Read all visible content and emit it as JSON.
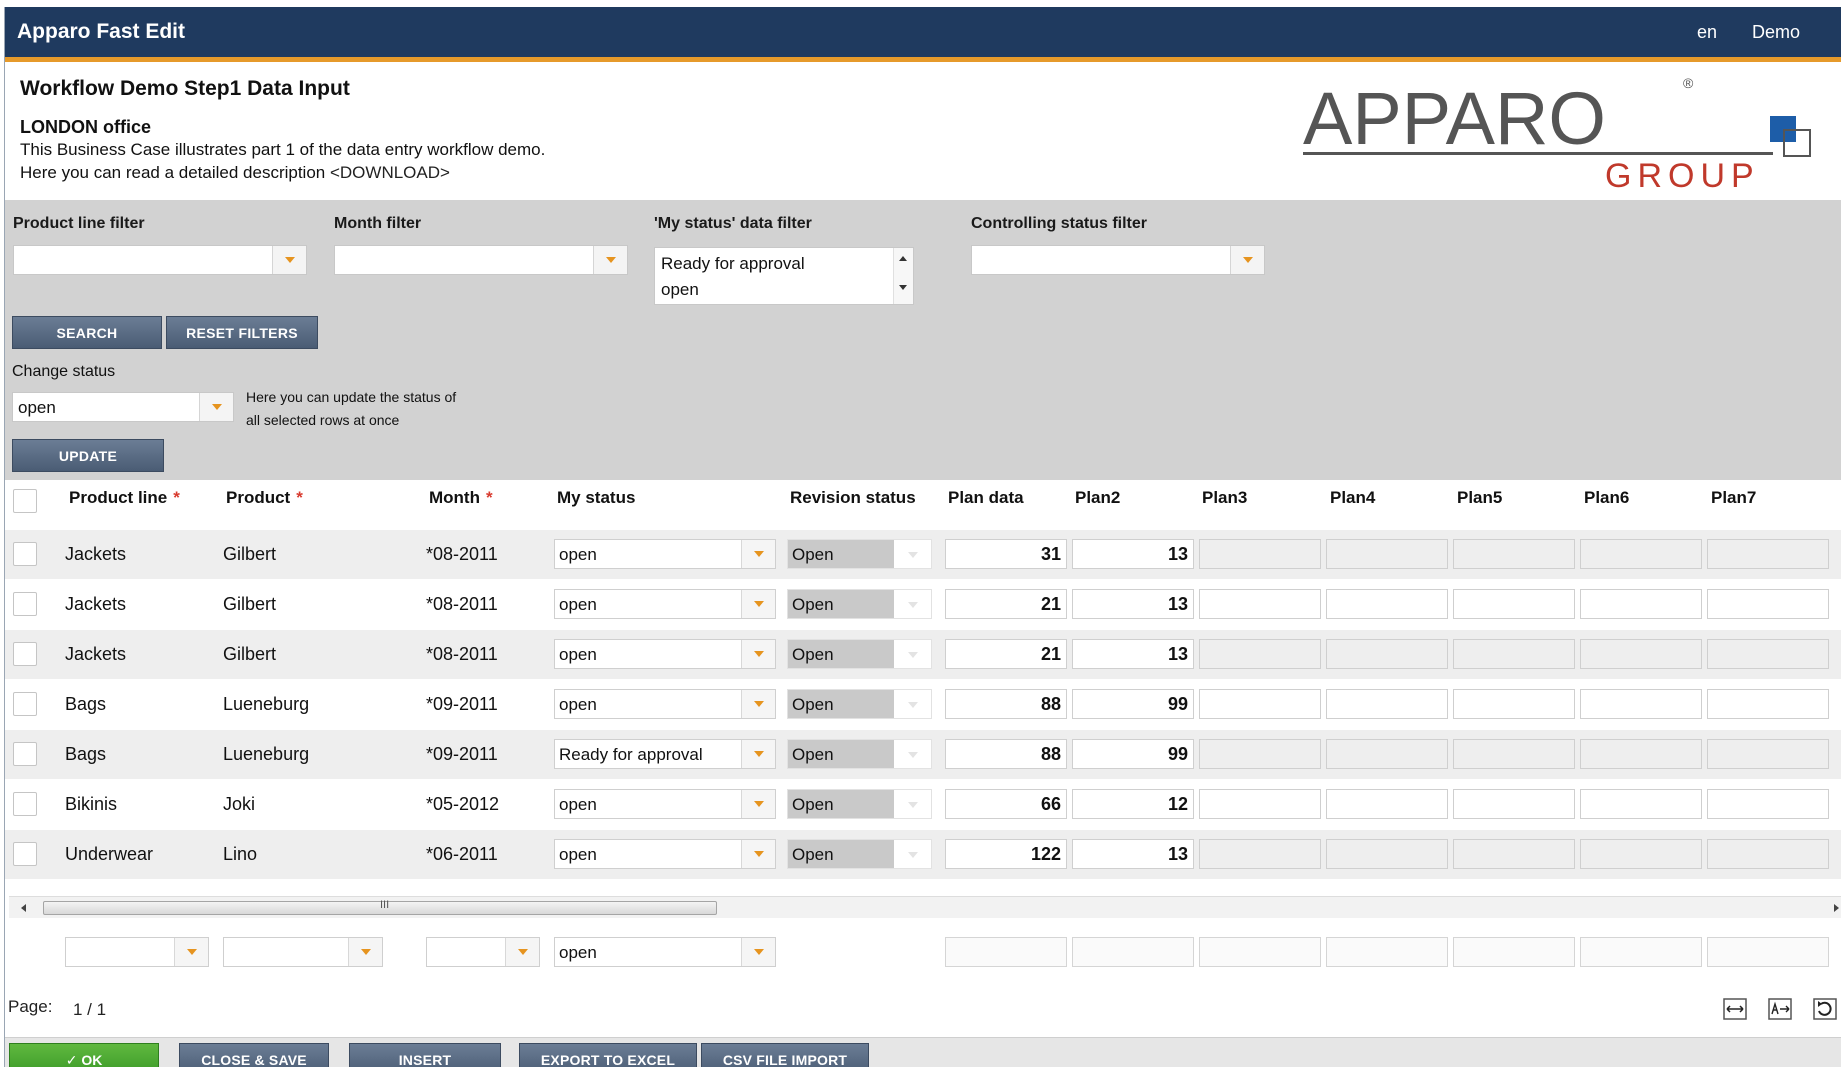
{
  "app": {
    "title": "Apparo Fast Edit",
    "language": "en",
    "user": "Demo"
  },
  "header": {
    "title": "Workflow Demo Step1 Data Input",
    "office": "LONDON office",
    "desc_line1": "This Business Case illustrates part 1 of the data entry workflow demo.",
    "desc_line2": "Here you can read a detailed description ",
    "desc_link": "<DOWNLOAD>",
    "logo_top": "APPARO",
    "logo_bottom": "GROUP",
    "logo_mark": "®"
  },
  "filters": {
    "product_line_label": "Product line filter",
    "month_label": "Month filter",
    "my_status_label": "'My status' data filter",
    "my_status_options": [
      "Ready for approval",
      "open"
    ],
    "controlling_label": "Controlling status filter",
    "search_button": "SEARCH",
    "reset_button": "RESET FILTERS",
    "change_status_label": "Change status",
    "change_status_value": "open",
    "change_status_hint1": "Here you can update the status of",
    "change_status_hint2": "all selected rows at once",
    "update_button": "UPDATE"
  },
  "grid": {
    "columns": {
      "product_line": "Product line",
      "product": "Product",
      "month": "Month",
      "required_mark": "*",
      "my_status": "My status",
      "revision_status": "Revision status",
      "plan_data": "Plan data",
      "plan2": "Plan2",
      "plan3": "Plan3",
      "plan4": "Plan4",
      "plan5": "Plan5",
      "plan6": "Plan6",
      "plan7": "Plan7"
    },
    "rows": [
      {
        "product_line": "Jackets",
        "product": "Gilbert",
        "month": "*08-2011",
        "my_status": "open",
        "revision_status": "Open",
        "plan_data": "31",
        "plan2": "13"
      },
      {
        "product_line": "Jackets",
        "product": "Gilbert",
        "month": "*08-2011",
        "my_status": "open",
        "revision_status": "Open",
        "plan_data": "21",
        "plan2": "13"
      },
      {
        "product_line": "Jackets",
        "product": "Gilbert",
        "month": "*08-2011",
        "my_status": "open",
        "revision_status": "Open",
        "plan_data": "21",
        "plan2": "13"
      },
      {
        "product_line": "Bags",
        "product": "Lueneburg",
        "month": "*09-2011",
        "my_status": "open",
        "revision_status": "Open",
        "plan_data": "88",
        "plan2": "99"
      },
      {
        "product_line": "Bags",
        "product": "Lueneburg",
        "month": "*09-2011",
        "my_status": "Ready for approval",
        "revision_status": "Open",
        "plan_data": "88",
        "plan2": "99"
      },
      {
        "product_line": "Bikinis",
        "product": "Joki",
        "month": "*05-2012",
        "my_status": "open",
        "revision_status": "Open",
        "plan_data": "66",
        "plan2": "12"
      },
      {
        "product_line": "Underwear",
        "product": "Lino",
        "month": "*06-2011",
        "my_status": "open",
        "revision_status": "Open",
        "plan_data": "122",
        "plan2": "13"
      }
    ],
    "scroll_grip": "III",
    "new_row_status": "open"
  },
  "footer": {
    "page_label": "Page:",
    "page_value": "1 / 1",
    "tool_icons": [
      "fit-width-icon",
      "text-width-icon",
      "reset-icon"
    ]
  },
  "actions": {
    "ok_check": "✓",
    "ok": "OK",
    "close_save": "CLOSE & SAVE",
    "insert": "INSERT",
    "export_excel": "EXPORT TO EXCEL",
    "csv_import": "CSV FILE IMPORT"
  },
  "colors": {
    "titlebar": "#1f3a5f",
    "accent": "#e69a2b",
    "button": "#55677f",
    "ok_button": "#4aa833",
    "logo_gray": "#555555",
    "logo_red": "#c0392b",
    "logo_blue": "#1d5da8"
  }
}
